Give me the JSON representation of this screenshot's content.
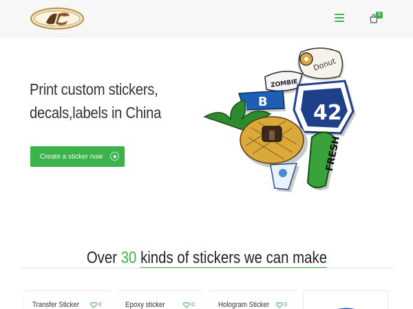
{
  "header": {
    "logo_alt": "JC logo",
    "menu_icon": "hamburger-menu-icon",
    "cart_icon": "shopping-bag-icon",
    "cart_count": "0"
  },
  "hero": {
    "title_line1": "Print custom stickers,",
    "title_line2": "decals,labels in China",
    "cta_label": "Create a sticker now",
    "cta_icon": "play-circle-icon"
  },
  "section": {
    "title_pre": "Over",
    "title_num": "30",
    "title_mid": "kinds of stickers we can make"
  },
  "products": [
    {
      "name": "Transfer Sticker",
      "likes": "0"
    },
    {
      "name": "Epoxy sticker",
      "likes": "0"
    },
    {
      "name": "Hologram Sticker",
      "likes": "0"
    }
  ],
  "colors": {
    "accent": "#3bb34a",
    "logo_gold": "#c8a25a",
    "logo_dark": "#5a3a1a"
  }
}
